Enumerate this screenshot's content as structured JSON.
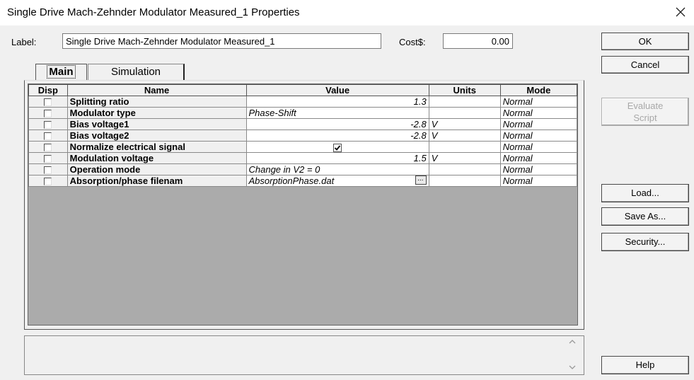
{
  "window": {
    "title": "Single Drive Mach-Zehnder Modulator Measured_1 Properties",
    "close_glyph": "✕"
  },
  "header": {
    "label_caption": "Label:",
    "label_value": "Single Drive Mach-Zehnder Modulator Measured_1",
    "cost_caption": "Cost$:",
    "cost_value": "0.00"
  },
  "tabs": [
    {
      "label": "Main",
      "active": true
    },
    {
      "label": "Simulation",
      "active": false
    }
  ],
  "table": {
    "columns": [
      "Disp",
      "Name",
      "Value",
      "Units",
      "Mode"
    ],
    "rows": [
      {
        "name": "Splitting ratio",
        "value": "1.3",
        "units": "",
        "mode": "Normal",
        "kind": "num"
      },
      {
        "name": "Modulator type",
        "value": "Phase-Shift",
        "units": "",
        "mode": "Normal",
        "kind": "text"
      },
      {
        "name": "Bias voltage1",
        "value": "-2.8",
        "units": "V",
        "mode": "Normal",
        "kind": "num"
      },
      {
        "name": "Bias voltage2",
        "value": "-2.8",
        "units": "V",
        "mode": "Normal",
        "kind": "num"
      },
      {
        "name": "Normalize electrical signal",
        "value": "",
        "units": "",
        "mode": "Normal",
        "kind": "check",
        "checked": true
      },
      {
        "name": "Modulation voltage",
        "value": "1.5",
        "units": "V",
        "mode": "Normal",
        "kind": "num"
      },
      {
        "name": "Operation mode",
        "value": "Change in V2 = 0",
        "units": "",
        "mode": "Normal",
        "kind": "text"
      },
      {
        "name": "Absorption/phase filenam",
        "value": "AbsorptionPhase.dat",
        "units": "",
        "mode": "Normal",
        "kind": "file",
        "button_label": "..."
      }
    ]
  },
  "buttons": {
    "ok": "OK",
    "cancel": "Cancel",
    "evaluate_script": "Evaluate\nScript",
    "load": "Load...",
    "save_as": "Save As...",
    "security": "Security...",
    "help": "Help"
  },
  "icons": {
    "scroll_up": "chevron-up-icon",
    "scroll_down": "chevron-down-icon",
    "close": "close-icon",
    "checkmark": "checkmark-icon"
  },
  "colors": {
    "dialog_bg": "#f0f0f0",
    "grid_bg": "#ababab",
    "disabled_text": "#a8a8a8"
  }
}
